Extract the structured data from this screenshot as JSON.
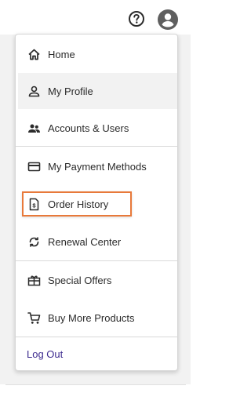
{
  "topbar": {
    "help_icon": "help-circle-icon",
    "user_icon": "account-circle-icon"
  },
  "menu": {
    "items": [
      {
        "label": "Home",
        "icon": "home-icon"
      },
      {
        "label": "My Profile",
        "icon": "person-icon"
      },
      {
        "label": "Accounts & Users",
        "icon": "people-icon"
      },
      {
        "label": "My Payment Methods",
        "icon": "credit-card-icon"
      },
      {
        "label": "Order History",
        "icon": "receipt-icon"
      },
      {
        "label": "Renewal Center",
        "icon": "renew-icon"
      },
      {
        "label": "Special Offers",
        "icon": "gift-icon"
      },
      {
        "label": "Buy More Products",
        "icon": "cart-icon"
      }
    ],
    "logout_label": "Log Out"
  },
  "colors": {
    "highlight": "#e8793a",
    "logout": "#3d2b8f",
    "hover_bg": "#f2f2f2"
  }
}
